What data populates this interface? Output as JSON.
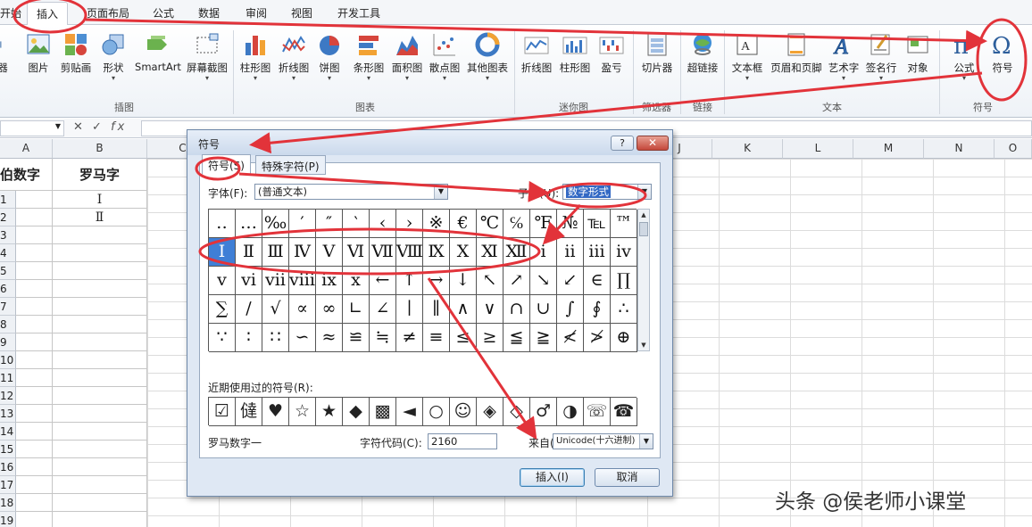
{
  "ribbon": {
    "tabs": [
      "开始",
      "插入",
      "页面布局",
      "公式",
      "数据",
      "审阅",
      "视图",
      "开发工具"
    ],
    "buttons": [
      {
        "label": "器",
        "icon": "partial-icon"
      },
      {
        "label": "图片",
        "icon": "picture-icon"
      },
      {
        "label": "剪贴画",
        "icon": "clipart-icon"
      },
      {
        "label": "形状",
        "icon": "shapes-icon"
      },
      {
        "label": "SmartArt",
        "icon": "smartart-icon"
      },
      {
        "label": "屏幕截图",
        "icon": "screenshot-icon"
      },
      {
        "label": "柱形图",
        "icon": "column-chart-icon"
      },
      {
        "label": "折线图",
        "icon": "line-chart-icon"
      },
      {
        "label": "饼图",
        "icon": "pie-chart-icon"
      },
      {
        "label": "条形图",
        "icon": "bar-chart-icon"
      },
      {
        "label": "面积图",
        "icon": "area-chart-icon"
      },
      {
        "label": "散点图",
        "icon": "scatter-chart-icon"
      },
      {
        "label": "其他图表",
        "icon": "other-chart-icon"
      },
      {
        "label": "折线图",
        "icon": "sparkline-line-icon"
      },
      {
        "label": "柱形图",
        "icon": "sparkline-column-icon"
      },
      {
        "label": "盈亏",
        "icon": "sparkline-winloss-icon"
      },
      {
        "label": "切片器",
        "icon": "slicer-icon"
      },
      {
        "label": "超链接",
        "icon": "hyperlink-icon"
      },
      {
        "label": "文本框",
        "icon": "textbox-icon"
      },
      {
        "label": "页眉和页脚",
        "icon": "header-footer-icon"
      },
      {
        "label": "艺术字",
        "icon": "wordart-icon"
      },
      {
        "label": "签名行",
        "icon": "signature-icon"
      },
      {
        "label": "对象",
        "icon": "object-icon"
      },
      {
        "label": "公式",
        "icon": "equation-icon"
      },
      {
        "label": "符号",
        "icon": "omega-icon"
      }
    ],
    "groups": [
      "插图",
      "图表",
      "迷你图",
      "筛选器",
      "链接",
      "文本",
      "符号"
    ]
  },
  "formula_bar": {
    "fx": "fx",
    "buttons": "✕ ✓"
  },
  "sheet": {
    "columns": [
      "A",
      "B",
      "C",
      "D",
      "E",
      "F",
      "G",
      "H",
      "I",
      "J",
      "K",
      "L",
      "M",
      "N",
      "O"
    ],
    "header_a": "伯数字",
    "header_b": "罗马字",
    "rows": [
      "1",
      "2",
      "3",
      "4",
      "5",
      "6",
      "7",
      "8",
      "9",
      "10",
      "11",
      "12",
      "13",
      "14",
      "15",
      "16",
      "17",
      "18",
      "19"
    ],
    "col_b_values": [
      "Ⅰ",
      "Ⅱ"
    ]
  },
  "dialog": {
    "title": "符号",
    "help": "?",
    "close": "✕",
    "tabs": [
      "符号(S)",
      "特殊字符(P)"
    ],
    "font_label": "字体(F):",
    "font_value": "(普通文本)",
    "subset_label": "子集(U):",
    "subset_value": "数字形式",
    "symbols": [
      [
        "‥",
        "…",
        "‰",
        "′",
        "″",
        "‵",
        "‹",
        "›",
        "※",
        "€",
        "℃",
        "℅",
        "℉",
        "№",
        "℡",
        "™"
      ],
      [
        "Ⅰ",
        "Ⅱ",
        "Ⅲ",
        "Ⅳ",
        "Ⅴ",
        "Ⅵ",
        "Ⅶ",
        "Ⅷ",
        "Ⅸ",
        "Ⅹ",
        "Ⅺ",
        "Ⅻ",
        "ⅰ",
        "ⅱ",
        "ⅲ",
        "ⅳ"
      ],
      [
        "ⅴ",
        "ⅵ",
        "ⅶ",
        "ⅷ",
        "ⅸ",
        "ⅹ",
        "←",
        "↑",
        "→",
        "↓",
        "↖",
        "↗",
        "↘",
        "↙",
        "∈",
        "∏"
      ],
      [
        "∑",
        "∕",
        "√",
        "∝",
        "∞",
        "∟",
        "∠",
        "∣",
        "∥",
        "∧",
        "∨",
        "∩",
        "∪",
        "∫",
        "∮",
        "∴"
      ],
      [
        "∵",
        "∶",
        "∷",
        "∽",
        "≈",
        "≌",
        "≒",
        "≠",
        "≡",
        "≤",
        "≥",
        "≦",
        "≧",
        "≮",
        "≯",
        "⊕"
      ]
    ],
    "recent_label": "近期使用过的符号(R):",
    "recent": [
      "☑",
      "㒓",
      "♥",
      "☆",
      "★",
      "◆",
      "▩",
      "◄",
      "○",
      "☺",
      "◈",
      "◇",
      "♂",
      "◑",
      "☏",
      "☎"
    ],
    "char_name": "罗马数字一",
    "code_label": "字符代码(C):",
    "code_value": "2160",
    "from_label": "来自(M):",
    "from_value": "Unicode(十六进制)",
    "insert": "插入(I)",
    "cancel": "取消"
  },
  "watermark": "头条 @侯老师小课堂",
  "colors": {
    "annotation_red": "#e2333a",
    "selection_blue": "#3f7fd6"
  }
}
